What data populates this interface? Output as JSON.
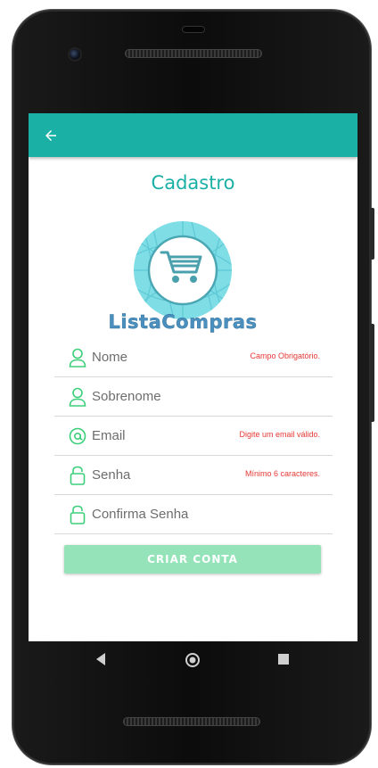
{
  "screen": {
    "title": "Cadastro",
    "logo_text": "ListaCompras"
  },
  "form": {
    "fields": [
      {
        "placeholder": "Nome",
        "error": "Campo Obrigatório.",
        "icon": "person-icon"
      },
      {
        "placeholder": "Sobrenome",
        "error": "",
        "icon": "person-icon"
      },
      {
        "placeholder": "Email",
        "error": "Digite um email válido.",
        "icon": "at-sign-icon"
      },
      {
        "placeholder": "Senha",
        "error": "Mínimo 6 caracteres.",
        "icon": "lock-icon"
      },
      {
        "placeholder": "Confirma Senha",
        "error": "",
        "icon": "lock-icon"
      }
    ],
    "submit_label": "CRIAR CONTA"
  },
  "colors": {
    "accent": "#1ab0a6",
    "icon_green": "#3ccf7a",
    "error_red": "#e53935",
    "button_disabled": "#95e3b9",
    "logo_blue": "#4a8fbd"
  }
}
